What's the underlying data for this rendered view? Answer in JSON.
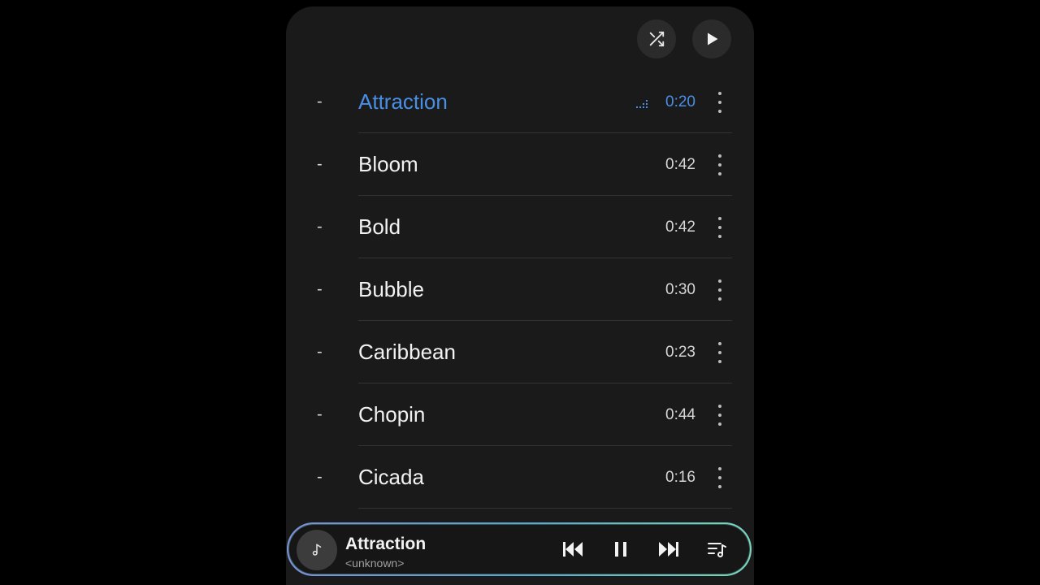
{
  "header": {
    "shuffle_icon": "shuffle-icon",
    "play_icon": "play-icon"
  },
  "tracks": [
    {
      "index_marker": "-",
      "title": "Attraction",
      "duration": "0:20",
      "active": true
    },
    {
      "index_marker": "-",
      "title": "Bloom",
      "duration": "0:42",
      "active": false
    },
    {
      "index_marker": "-",
      "title": "Bold",
      "duration": "0:42",
      "active": false
    },
    {
      "index_marker": "-",
      "title": "Bubble",
      "duration": "0:30",
      "active": false
    },
    {
      "index_marker": "-",
      "title": "Caribbean",
      "duration": "0:23",
      "active": false
    },
    {
      "index_marker": "-",
      "title": "Chopin",
      "duration": "0:44",
      "active": false
    },
    {
      "index_marker": "-",
      "title": "Cicada",
      "duration": "0:16",
      "active": false
    }
  ],
  "now_playing": {
    "title": "Attraction",
    "artist": "<unknown>"
  },
  "colors": {
    "accent": "#4a8fe6",
    "background": "#1a1a1a",
    "page": "#000000"
  }
}
